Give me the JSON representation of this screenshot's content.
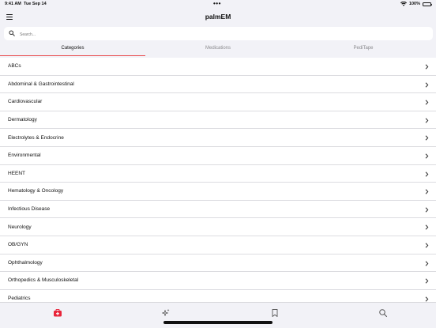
{
  "status": {
    "time": "9:41 AM",
    "date": "Tue Sep 14",
    "battery": "100%"
  },
  "nav": {
    "title": "palmEM"
  },
  "search": {
    "placeholder": "Search..."
  },
  "tabs": [
    {
      "label": "Categories",
      "active": true
    },
    {
      "label": "Medications",
      "active": false
    },
    {
      "label": "PediTape",
      "active": false
    }
  ],
  "categories": [
    "ABCs",
    "Abdominal & Gastrointestinal",
    "Cardiovascular",
    "Dermatology",
    "Electrolytes & Endocrine",
    "Environmental",
    "HEENT",
    "Hematology & Oncology",
    "Infectious Disease",
    "Neurology",
    "OB/GYN",
    "Ophthalmology",
    "Orthopedics & Musculoskeletal",
    "Pediatrics"
  ],
  "bottom_tabs": [
    {
      "icon": "medical-kit-icon",
      "color": "#e8243a",
      "selected": true
    },
    {
      "icon": "sparkles-icon",
      "color": "#555555",
      "selected": false
    },
    {
      "icon": "bookmark-icon",
      "color": "#555555",
      "selected": false
    },
    {
      "icon": "search-icon",
      "color": "#555555",
      "selected": false
    }
  ],
  "colors": {
    "accent": "#e8474a",
    "background": "#f2f2f7"
  }
}
